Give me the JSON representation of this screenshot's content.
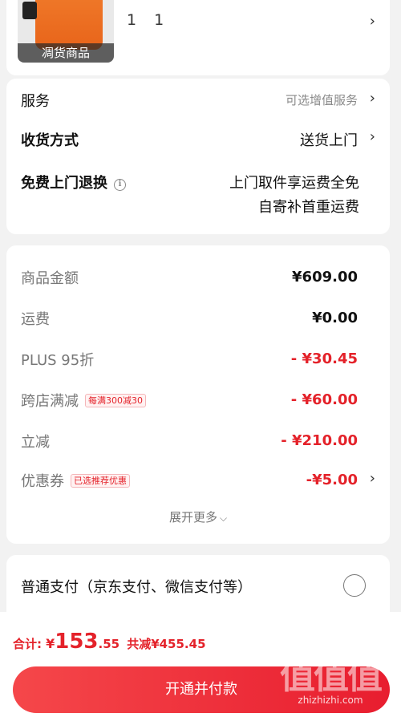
{
  "product": {
    "thumb_label": "凋货商品",
    "quantity": "1 1"
  },
  "service_card": {
    "service": {
      "label": "服务",
      "value": "可选增值服务"
    },
    "delivery": {
      "label": "收货方式",
      "value": "送货上门"
    },
    "return": {
      "label": "免费上门退换",
      "value_line1": "上门取件享运费全免",
      "value_line2": "自寄补首重运费"
    }
  },
  "price_card": {
    "goods": {
      "label": "商品金额",
      "value": "¥609.00"
    },
    "shipping": {
      "label": "运费",
      "value": "¥0.00"
    },
    "plus": {
      "label": "PLUS 95折",
      "value": "- ¥30.45"
    },
    "cross_store": {
      "label": "跨店满减",
      "tag": "每满300减30",
      "value": "- ¥60.00"
    },
    "instant": {
      "label": "立减",
      "value": "- ¥210.00"
    },
    "coupon": {
      "label": "优惠券",
      "tag": "已选推荐优惠",
      "value": "-¥5.00"
    },
    "expand": "展开更多"
  },
  "payment": {
    "option": "普通支付（京东支付、微信支付等）"
  },
  "footer": {
    "total_prefix": "合计:",
    "total_currency": "¥",
    "total_integer": "153",
    "total_decimal": ".55",
    "saved": "共减¥455.45",
    "pay_button": "开通并付款"
  },
  "watermark": {
    "mark": "值值值",
    "url": "zhizhizhi.com"
  },
  "colors": {
    "accent": "#e4222a",
    "button": "#ec2c3a"
  }
}
